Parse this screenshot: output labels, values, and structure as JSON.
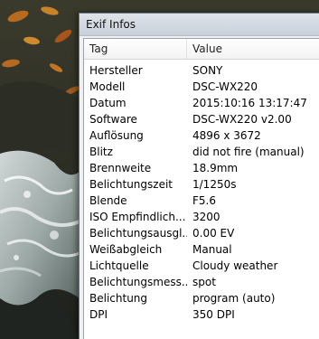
{
  "window": {
    "title": "Exif Infos"
  },
  "table": {
    "columns": [
      "Tag",
      "Value"
    ],
    "rows": [
      {
        "tag": "Hersteller",
        "value": "SONY"
      },
      {
        "tag": "Modell",
        "value": "DSC-WX220"
      },
      {
        "tag": "Datum",
        "value": "2015:10:16 13:17:47"
      },
      {
        "tag": "Software",
        "value": "DSC-WX220 v2.00"
      },
      {
        "tag": "Auflösung",
        "value": "4896 x 3672"
      },
      {
        "tag": "Blitz",
        "value": "did not fire (manual)"
      },
      {
        "tag": "Brennweite",
        "value": "18.9mm"
      },
      {
        "tag": "Belichtungszeit",
        "value": "1/1250s"
      },
      {
        "tag": "Blende",
        "value": "F5.6"
      },
      {
        "tag": "ISO Empfindlich...",
        "value": "3200"
      },
      {
        "tag": "Belichtungsausgl...",
        "value": "0.00 EV"
      },
      {
        "tag": "Weißabgleich",
        "value": "Manual"
      },
      {
        "tag": "Lichtquelle",
        "value": "Cloudy weather"
      },
      {
        "tag": "Belichtungsmess...",
        "value": "spot"
      },
      {
        "tag": "Belichtung",
        "value": "program (auto)"
      },
      {
        "tag": "DPI",
        "value": "350 DPI"
      }
    ]
  }
}
